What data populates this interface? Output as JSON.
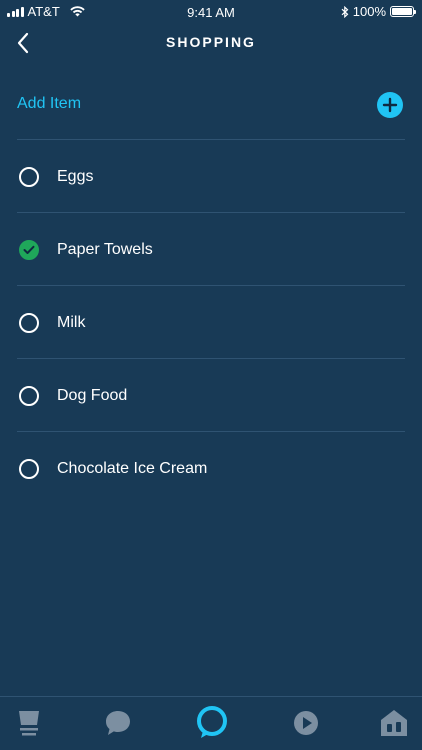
{
  "status": {
    "carrier": "AT&T",
    "time": "9:41 AM",
    "battery": "100%"
  },
  "header": {
    "title": "SHOPPING"
  },
  "add_item": {
    "label": "Add Item"
  },
  "items": [
    {
      "label": "Eggs",
      "checked": false
    },
    {
      "label": "Paper Towels",
      "checked": true
    },
    {
      "label": "Milk",
      "checked": false
    },
    {
      "label": "Dog Food",
      "checked": false
    },
    {
      "label": "Chocolate Ice Cream",
      "checked": false
    }
  ],
  "tabs": [
    {
      "icon": "home-icon"
    },
    {
      "icon": "chat-icon"
    },
    {
      "icon": "alexa-icon"
    },
    {
      "icon": "play-icon"
    },
    {
      "icon": "devices-icon"
    }
  ],
  "colors": {
    "background": "#183a56",
    "accent": "#20c4f4",
    "check": "#1fa75a",
    "divider": "#2f5372",
    "tab_inactive": "#7c8fa1"
  }
}
